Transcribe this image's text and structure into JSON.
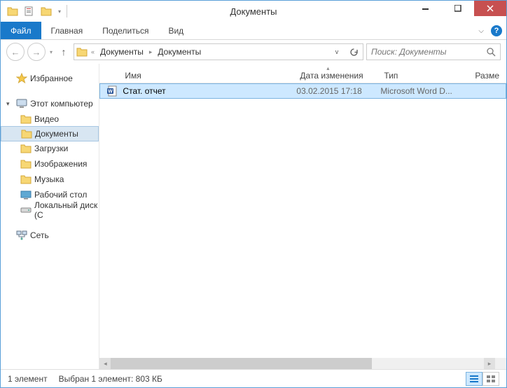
{
  "window": {
    "title": "Документы"
  },
  "ribbon": {
    "tabs": {
      "file": "Файл",
      "home": "Главная",
      "share": "Поделиться",
      "view": "Вид"
    }
  },
  "address": {
    "crumbs": [
      "Документы",
      "Документы"
    ]
  },
  "search": {
    "placeholder": "Поиск: Документы"
  },
  "sidebar": {
    "favorites": "Избранное",
    "computer": "Этот компьютер",
    "items": {
      "videos": "Видео",
      "documents": "Документы",
      "downloads": "Загрузки",
      "pictures": "Изображения",
      "music": "Музыка",
      "desktop": "Рабочий стол",
      "localdisk": "Локальный диск (C"
    },
    "network": "Сеть"
  },
  "columns": {
    "name": "Имя",
    "date": "Дата изменения",
    "type": "Тип",
    "size": "Разме"
  },
  "files": [
    {
      "name": "Стат. отчет",
      "date": "03.02.2015 17:18",
      "type": "Microsoft Word D..."
    }
  ],
  "status": {
    "count": "1 элемент",
    "selection": "Выбран 1 элемент: 803 КБ"
  }
}
